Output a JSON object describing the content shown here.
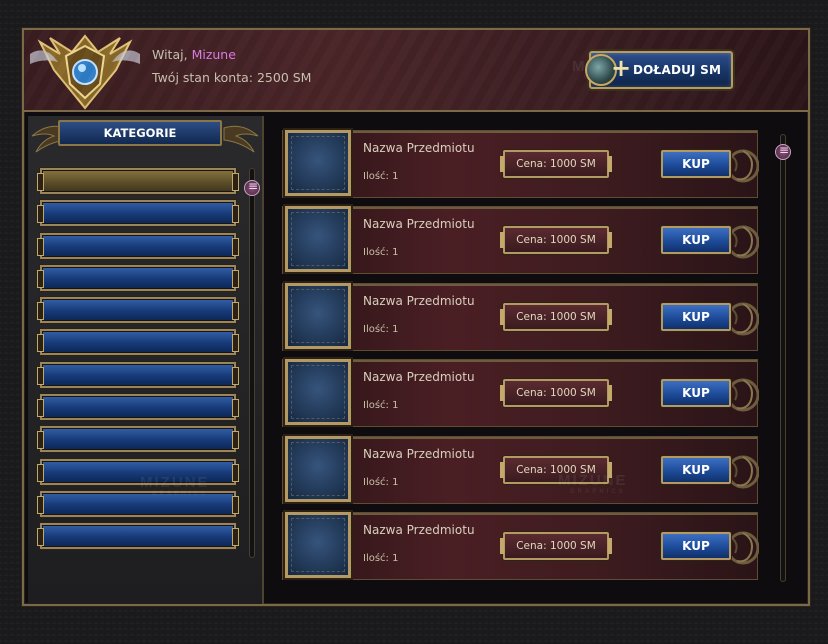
{
  "header": {
    "greeting_prefix": "Witaj,",
    "username": "Mizune",
    "balance_text": "Twój stan konta: 2500 SM",
    "topup_label": "DOŁADUJ SM",
    "emblem_icon": "crest-emblem-icon"
  },
  "watermark": {
    "main": "MIZUNE",
    "sub": "GRAPHICS"
  },
  "sidebar": {
    "header": "KATEGORIE",
    "category_count": 12,
    "active_index": 0
  },
  "items": [
    {
      "name": "Nazwa Przedmiotu",
      "qty": "Ilość: 1",
      "price": "Cena: 1000 SM",
      "buy": "KUP"
    },
    {
      "name": "Nazwa Przedmiotu",
      "qty": "Ilość: 1",
      "price": "Cena: 1000 SM",
      "buy": "KUP"
    },
    {
      "name": "Nazwa Przedmiotu",
      "qty": "Ilość: 1",
      "price": "Cena: 1000 SM",
      "buy": "KUP"
    },
    {
      "name": "Nazwa Przedmiotu",
      "qty": "Ilość: 1",
      "price": "Cena: 1000 SM",
      "buy": "KUP"
    },
    {
      "name": "Nazwa Przedmiotu",
      "qty": "Ilość: 1",
      "price": "Cena: 1000 SM",
      "buy": "KUP"
    },
    {
      "name": "Nazwa Przedmiotu",
      "qty": "Ilość: 1",
      "price": "Cena: 1000 SM",
      "buy": "KUP"
    }
  ],
  "colors": {
    "gold_border": "#b49a62",
    "button_blue": "#1d4b99",
    "row_red": "#4a1f24",
    "username_pink": "#d77be0"
  }
}
